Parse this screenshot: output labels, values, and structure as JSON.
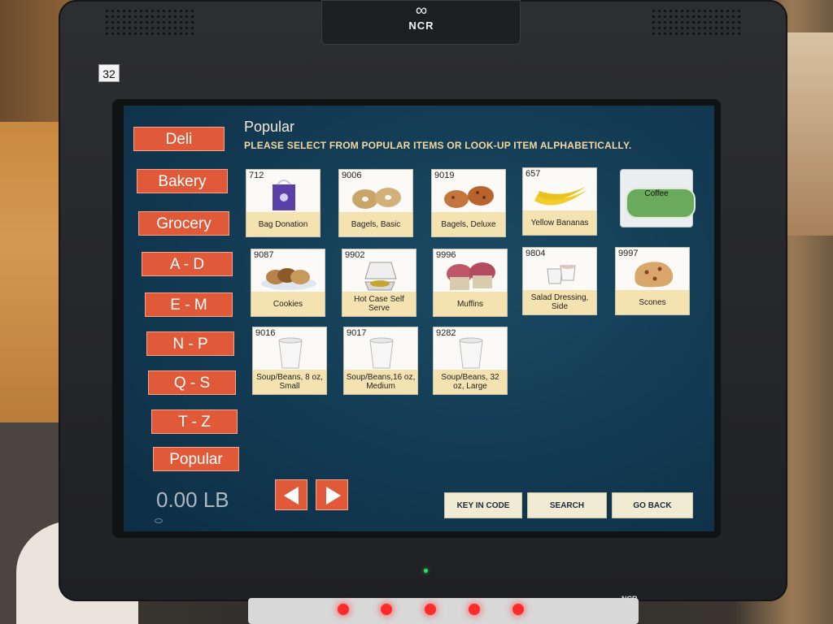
{
  "device": {
    "brand": "NCR",
    "station_number": "32",
    "bottom_brand": "NCR"
  },
  "screen": {
    "title": "Popular",
    "instruction": "PLEASE SELECT FROM POPULAR ITEMS OR LOOK-UP ITEM ALPHABETICALLY.",
    "nav": [
      "Deli",
      "Bakery",
      "Grocery",
      "A - D",
      "E - M",
      "N - P",
      "Q - S",
      "T - Z",
      "Popular"
    ],
    "items": [
      {
        "code": "712",
        "label": "Bag Donation",
        "icon": "bag-icon"
      },
      {
        "code": "9006",
        "label": "Bagels, Basic",
        "icon": "bagel-icon"
      },
      {
        "code": "9019",
        "label": "Bagels, Deluxe",
        "icon": "bagel-icon"
      },
      {
        "code": "657",
        "label": "Yellow Bananas",
        "icon": "banana-icon"
      },
      {
        "code": "9087",
        "label": "Cookies",
        "icon": "cookie-icon"
      },
      {
        "code": "9902",
        "label": "Hot Case Self Serve",
        "icon": "container-icon"
      },
      {
        "code": "9996",
        "label": "Muffins",
        "icon": "muffin-icon"
      },
      {
        "code": "9804",
        "label": "Salad Dressing, Side",
        "icon": "cup-icon"
      },
      {
        "code": "9997",
        "label": "Scones",
        "icon": "scone-icon"
      },
      {
        "code": "9016",
        "label": "Soup/Beans, 8 oz, Small",
        "icon": "soup-cup-icon"
      },
      {
        "code": "9017",
        "label": "Soup/Beans,16 oz, Medium",
        "icon": "soup-cup-icon"
      },
      {
        "code": "9282",
        "label": "Soup/Beans, 32 oz, Large",
        "icon": "soup-cup-icon"
      }
    ],
    "coffee_label": "Coffee",
    "weight": "0.00 LB",
    "buttons": {
      "key_in_code": "KEY IN CODE",
      "search": "SEARCH",
      "go_back": "GO BACK"
    }
  },
  "colors": {
    "nav_button": "#e05a3a",
    "screen_bg": "#123a52",
    "tile_label_bg": "#f4e3b0",
    "coffee_green": "#6aaa5c"
  }
}
